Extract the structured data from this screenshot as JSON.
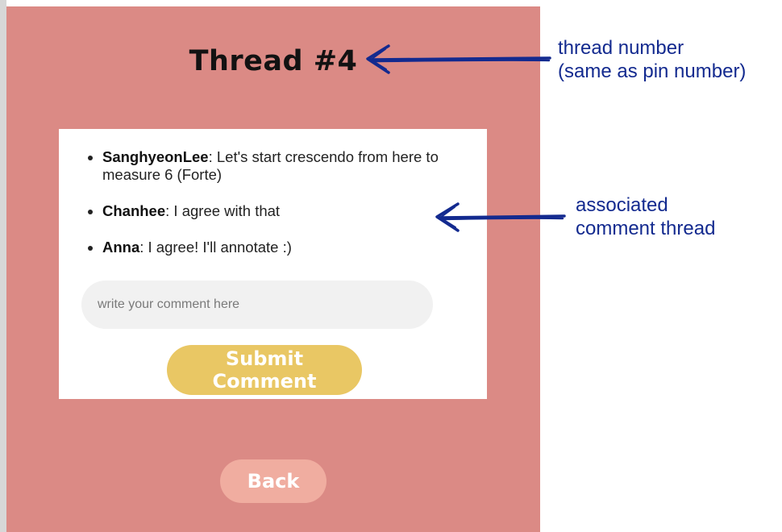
{
  "thread": {
    "title": "Thread #4"
  },
  "comments": [
    {
      "author": "SanghyeonLee",
      "text": "Let's start crescendo from here to measure 6 (Forte)"
    },
    {
      "author": "Chanhee",
      "text": "I agree with that"
    },
    {
      "author": "Anna",
      "text": "I agree! I'll annotate :)"
    }
  ],
  "comment_input": {
    "placeholder": "write your comment here",
    "value": ""
  },
  "buttons": {
    "submit_label": "Submit Comment",
    "back_label": "Back"
  },
  "annotations": {
    "thread_number_line1": "thread number",
    "thread_number_line2": "(same as pin number)",
    "comment_thread_line1": "associated",
    "comment_thread_line2": "comment thread"
  },
  "colors": {
    "panel_background": "#db8a85",
    "card_background": "#ffffff",
    "submit_button": "#e9c764",
    "back_button": "#f0ada0",
    "annotation_blue": "#132a8f"
  }
}
